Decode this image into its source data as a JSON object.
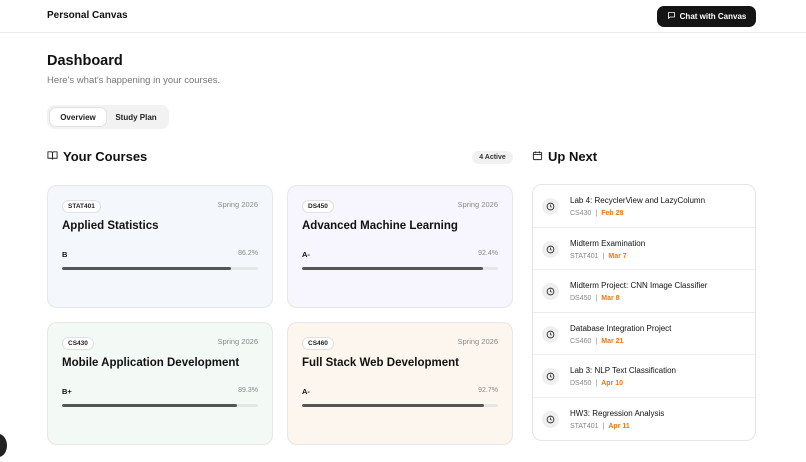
{
  "app": {
    "title": "Personal Canvas",
    "chat_button": "Chat with Canvas",
    "chat_icon": "message-square-icon"
  },
  "header": {
    "title": "Dashboard",
    "subtitle": "Here's what's happening in your courses."
  },
  "tabs": [
    {
      "label": "Overview",
      "active": true
    },
    {
      "label": "Study Plan",
      "active": false
    }
  ],
  "courses_section": {
    "title": "Your Courses",
    "badge": "4 Active",
    "icon": "book-open-icon"
  },
  "courses": [
    {
      "code": "STAT401",
      "term": "Spring 2026",
      "name": "Applied Statistics",
      "grade": "B",
      "percent": "86.2%",
      "progress": 0.862,
      "bg": "#f4f8fd"
    },
    {
      "code": "DS450",
      "term": "Spring 2026",
      "name": "Advanced Machine Learning",
      "grade": "A-",
      "percent": "92.4%",
      "progress": 0.924,
      "bg": "#f7f5fd"
    },
    {
      "code": "CS430",
      "term": "Spring 2026",
      "name": "Mobile Application Development",
      "grade": "B+",
      "percent": "89.3%",
      "progress": 0.893,
      "bg": "#f3faf6"
    },
    {
      "code": "CS460",
      "term": "Spring 2026",
      "name": "Full Stack Web Development",
      "grade": "A-",
      "percent": "92.7%",
      "progress": 0.927,
      "bg": "#fdf6ef"
    }
  ],
  "upnext_section": {
    "title": "Up Next",
    "icon": "calendar-icon"
  },
  "upnext": [
    {
      "title": "Lab 4: RecyclerView and LazyColumn",
      "course": "CS430",
      "separator": "|",
      "date": "Feb 28"
    },
    {
      "title": "Midterm Examination",
      "course": "STAT401",
      "separator": "|",
      "date": "Mar 7"
    },
    {
      "title": "Midterm Project: CNN Image Classifier",
      "course": "DS450",
      "separator": "|",
      "date": "Mar 8"
    },
    {
      "title": "Database Integration Project",
      "course": "CS460",
      "separator": "|",
      "date": "Mar 21"
    },
    {
      "title": "Lab 3: NLP Text Classification",
      "course": "DS450",
      "separator": "|",
      "date": "Apr 10"
    },
    {
      "title": "HW3: Regression Analysis",
      "course": "STAT401",
      "separator": "|",
      "date": "Apr 11"
    }
  ],
  "colors": {
    "accent_dark": "#141414",
    "due_date": "#e07a1f"
  }
}
